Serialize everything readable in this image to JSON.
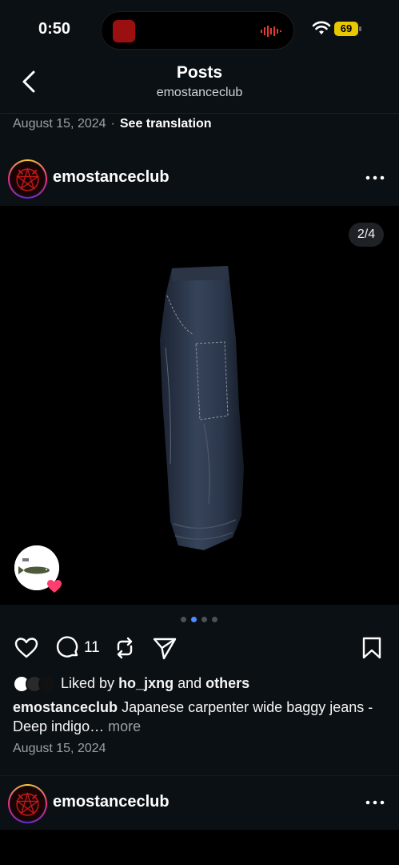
{
  "status_bar": {
    "time": "0:50",
    "battery": "69",
    "battery_color": "#e8c800",
    "icons": [
      "now-playing-art",
      "audio-wave-icon",
      "wifi-icon",
      "battery-icon"
    ]
  },
  "header": {
    "title": "Posts",
    "subtitle": "emostanceclub",
    "back_icon": "chevron-left-icon"
  },
  "previous_post": {
    "date": "August 15, 2024",
    "separator": "·",
    "translate_label": "See translation"
  },
  "post": {
    "username": "emostanceclub",
    "image_counter": "2/4",
    "carousel": {
      "count": 4,
      "active_index": 1
    },
    "comment_count": "11",
    "likes": {
      "prefix": "Liked by",
      "user": "ho_jxng",
      "connector": "and",
      "others": "others"
    },
    "caption": {
      "username": "emostanceclub",
      "text": "Japanese carpenter wide baggy jeans - Deep indigo…",
      "more_label": "more"
    },
    "date": "August 15, 2024"
  },
  "next_post": {
    "username": "emostanceclub"
  },
  "colors": {
    "background": "#0b1014",
    "accent_dot": "#4f8cff",
    "muted_text": "#9aa0a6",
    "heart": "#ff3d6e"
  }
}
